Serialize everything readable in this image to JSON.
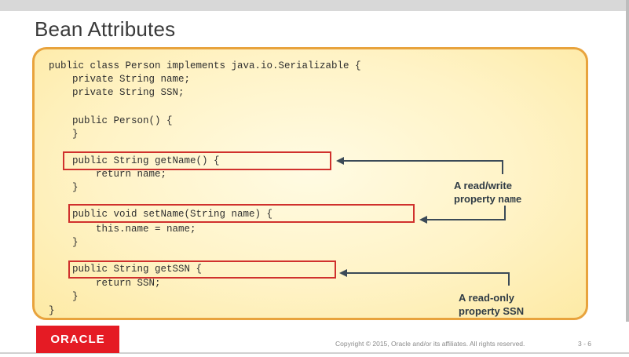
{
  "slide": {
    "title": "Bean Attributes",
    "code_lines": [
      "public class Person implements java.io.Serializable {",
      "    private String name;",
      "    private String SSN;",
      "",
      "    public Person() {",
      "    }",
      "",
      "    public String getName() {",
      "        return name;",
      "    }",
      "",
      "    public void setName(String name) {",
      "        this.name = name;",
      "    }",
      "",
      "    public String getSSN {",
      "        return SSN;",
      "    }",
      "}"
    ],
    "annotations": {
      "read_write_text": "A read/write",
      "read_write_prop_label": "property",
      "read_write_prop_name": "name",
      "read_only_text": "A read-only",
      "read_only_prop_label": "property",
      "read_only_prop_name": "SSN"
    }
  },
  "footer": {
    "logo_text": "ORACLE",
    "copyright": "Copyright © 2015, Oracle and/or its affiliates. All rights reserved.",
    "page_number": "3 - 6"
  },
  "colors": {
    "highlight_border": "#d0312d",
    "panel_border": "#e8a33d",
    "logo_bg": "#e51b24",
    "arrow": "#3b4a57"
  }
}
